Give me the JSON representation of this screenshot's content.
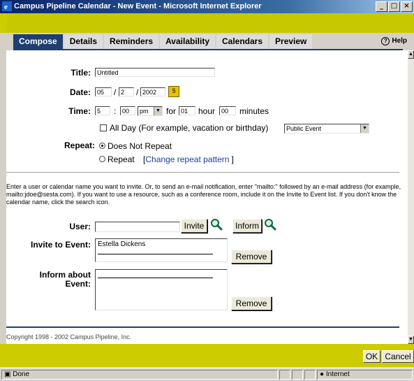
{
  "window": {
    "title": "Campus Pipeline Calendar - New Event - Microsoft Internet Explorer"
  },
  "tabs": [
    {
      "label": "Compose"
    },
    {
      "label": "Details"
    },
    {
      "label": "Reminders"
    },
    {
      "label": "Availability"
    },
    {
      "label": "Calendars"
    },
    {
      "label": "Preview"
    }
  ],
  "help_label": "Help",
  "form": {
    "title_label": "Title:",
    "title_value": "Untitled",
    "date_label": "Date:",
    "date_month": "05",
    "date_day": "2",
    "date_year": "2002",
    "date_sep": "/",
    "time_label": "Time:",
    "time_hour": "5",
    "time_sep": ":",
    "time_min": "00",
    "time_ampm": "pm",
    "for_text": "for",
    "duration_hours": "01",
    "hour_text": "hour",
    "duration_minutes": "00",
    "minutes_text": "minutes",
    "allday_label": "All Day (For example, vacation or birthday)",
    "event_type": "Public Event",
    "repeat_label": "Repeat:",
    "repeat_none": "Does Not Repeat",
    "repeat_text": "Repeat",
    "repeat_link": "Change repeat pattern",
    "bracket_open": "[",
    "bracket_close": "]"
  },
  "instructions": "Enter a user or calendar name you want to invite. Or, to send an e-mail notification, enter \"mailto:\" followed by an e-mail address (for example, mailto:jdoe@sesta.com). If you want to use a resource, such as a conference room, include it on the Invite to Event list. If you don't know the calendar name, click the search icon.",
  "invite": {
    "user_label": "User:",
    "user_value": "",
    "invite_button": "Invite",
    "inform_button": "Inform",
    "invite_to_label": "Invite to Event:",
    "invitees": [
      "Estella Dickens"
    ],
    "remove_button": "Remove",
    "inform_about_label_1": "Inform about",
    "inform_about_label_2": "Event:",
    "remove_button_2": "Remove"
  },
  "copyright": "Copyright 1998 - 2002 Campus Pipeline, Inc.",
  "buttons": {
    "ok": "OK",
    "cancel": "Cancel"
  },
  "status": {
    "left": "Done",
    "zone": "Internet"
  }
}
